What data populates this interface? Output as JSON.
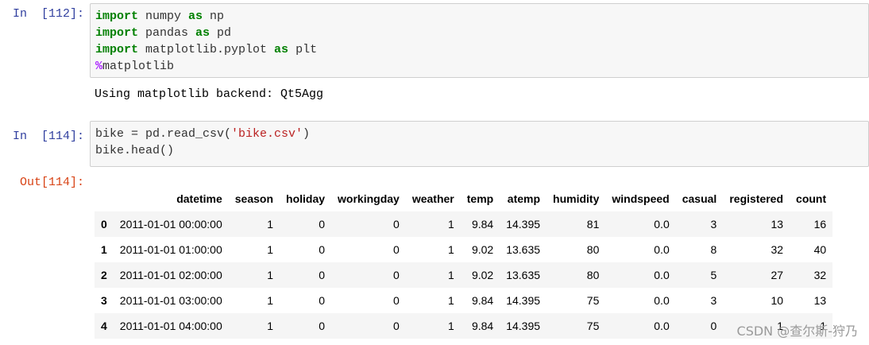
{
  "cells": [
    {
      "prompt": "In  [112]:",
      "lines": [
        [
          {
            "t": "import",
            "c": "kw"
          },
          {
            "t": " numpy ",
            "c": ""
          },
          {
            "t": "as",
            "c": "kw"
          },
          {
            "t": " np",
            "c": ""
          }
        ],
        [
          {
            "t": "import",
            "c": "kw"
          },
          {
            "t": " pandas ",
            "c": ""
          },
          {
            "t": "as",
            "c": "kw"
          },
          {
            "t": " pd",
            "c": ""
          }
        ],
        [
          {
            "t": "import",
            "c": "kw"
          },
          {
            "t": " matplotlib.pyplot ",
            "c": ""
          },
          {
            "t": "as",
            "c": "kw"
          },
          {
            "t": " plt",
            "c": ""
          }
        ],
        [
          {
            "t": "%",
            "c": "magic"
          },
          {
            "t": "matplotlib",
            "c": ""
          }
        ]
      ],
      "output": "Using matplotlib backend: Qt5Agg"
    },
    {
      "prompt": "In  [114]:",
      "lines": [
        [
          {
            "t": "bike = pd.read_csv(",
            "c": ""
          },
          {
            "t": "'bike.csv'",
            "c": "str"
          },
          {
            "t": ")",
            "c": ""
          }
        ],
        [
          {
            "t": "bike.head()",
            "c": ""
          }
        ]
      ],
      "out_prompt": "Out[114]:"
    }
  ],
  "table": {
    "columns": [
      "datetime",
      "season",
      "holiday",
      "workingday",
      "weather",
      "temp",
      "atemp",
      "humidity",
      "windspeed",
      "casual",
      "registered",
      "count"
    ],
    "rows": [
      {
        "index": "0",
        "values": [
          "2011-01-01 00:00:00",
          "1",
          "0",
          "0",
          "1",
          "9.84",
          "14.395",
          "81",
          "0.0",
          "3",
          "13",
          "16"
        ]
      },
      {
        "index": "1",
        "values": [
          "2011-01-01 01:00:00",
          "1",
          "0",
          "0",
          "1",
          "9.02",
          "13.635",
          "80",
          "0.0",
          "8",
          "32",
          "40"
        ]
      },
      {
        "index": "2",
        "values": [
          "2011-01-01 02:00:00",
          "1",
          "0",
          "0",
          "1",
          "9.02",
          "13.635",
          "80",
          "0.0",
          "5",
          "27",
          "32"
        ]
      },
      {
        "index": "3",
        "values": [
          "2011-01-01 03:00:00",
          "1",
          "0",
          "0",
          "1",
          "9.84",
          "14.395",
          "75",
          "0.0",
          "3",
          "10",
          "13"
        ]
      },
      {
        "index": "4",
        "values": [
          "2011-01-01 04:00:00",
          "1",
          "0",
          "0",
          "1",
          "9.84",
          "14.395",
          "75",
          "0.0",
          "0",
          "1",
          "1"
        ]
      }
    ]
  },
  "watermark": "CSDN @查尔斯-狩乃",
  "colors": {
    "input_prompt": "#303f9f",
    "output_prompt": "#d84315",
    "keyword": "#008000",
    "magic": "#aa22ff",
    "string": "#ba2121",
    "cell_background": "#f7f7f7",
    "cell_border": "#cfcfcf",
    "row_stripe": "#f5f5f5"
  }
}
